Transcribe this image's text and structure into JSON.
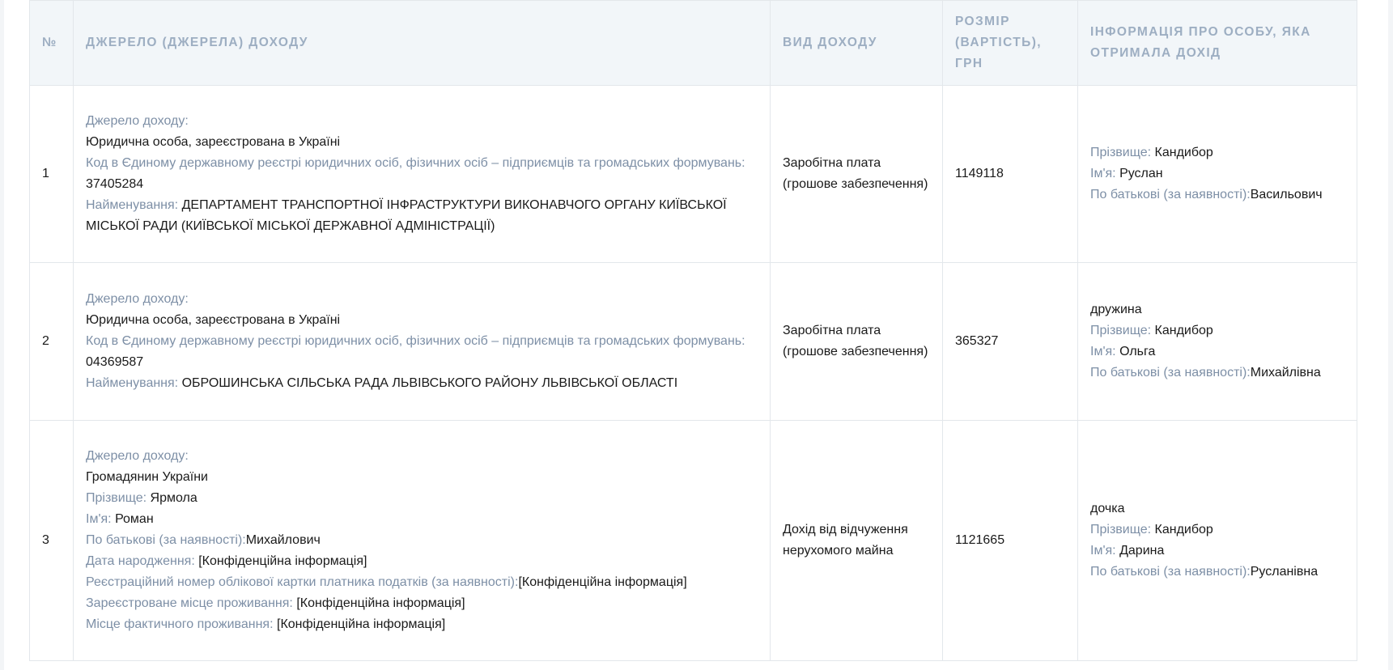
{
  "table": {
    "headers": {
      "no": "№",
      "source": "ДЖЕРЕЛО (ДЖЕРЕЛА) ДОХОДУ",
      "type": "ВИД ДОХОДУ",
      "amount": "РОЗМІР (ВАРТІСТЬ), ГРН",
      "person": "ІНФОРМАЦІЯ ПРО ОСОБУ, ЯКА ОТРИМАЛА ДОХІД"
    },
    "rows": [
      {
        "no": "1",
        "source": {
          "source_label": "Джерело доходу:",
          "entity_type": "Юридична особа, зареєстрована в Україні",
          "code_label": "Код в Єдиному державному реєстрі юридичних осіб, фізичних осіб – підприємців та громадських формувань:",
          "code_value": "37405284",
          "name_label": "Найменування:",
          "name_value": "ДЕПАРТАМЕНТ ТРАНСПОРТНОЇ ІНФРАСТРУКТУРИ ВИКОНАВЧОГО ОРГАНУ КИЇВСЬКОЇ МІСЬКОЇ РАДИ (КИЇВСЬКОЇ МІСЬКОЇ ДЕРЖАВНОЇ АДМІНІСТРАЦІЇ)"
        },
        "type": "Заробітна плата (грошове забезпечення)",
        "amount": "1149118",
        "person": {
          "relation": "",
          "surname_label": "Прізвище:",
          "surname_value": "Кандибор",
          "name_label": "Ім'я:",
          "name_value": "Руслан",
          "patronymic_label": "По батькові (за наявності):",
          "patronymic_value": "Васильович"
        }
      },
      {
        "no": "2",
        "source": {
          "source_label": "Джерело доходу:",
          "entity_type": "Юридична особа, зареєстрована в Україні",
          "code_label": "Код в Єдиному державному реєстрі юридичних осіб, фізичних осіб – підприємців та громадських формувань:",
          "code_value": "04369587",
          "name_label": "Найменування:",
          "name_value": "ОБРОШИНСЬКА СІЛЬСЬКА РАДА ЛЬВІВСЬКОГО РАЙОНУ ЛЬВІВСЬКОЇ ОБЛАСТІ"
        },
        "type": "Заробітна плата (грошове забезпечення)",
        "amount": "365327",
        "person": {
          "relation": "дружина",
          "surname_label": "Прізвище:",
          "surname_value": "Кандибор",
          "name_label": "Ім'я:",
          "name_value": "Ольга",
          "patronymic_label": "По батькові (за наявності):",
          "patronymic_value": "Михайлівна"
        }
      },
      {
        "no": "3",
        "source": {
          "source_label": "Джерело доходу:",
          "entity_type": "Громадянин України",
          "surname_label": "Прізвище:",
          "surname_value": "Ярмола",
          "name_label": "Ім'я:",
          "name_value": "Роман",
          "patronymic_label": "По батькові (за наявності):",
          "patronymic_value": "Михайлович",
          "birthdate_label": "Дата народження:",
          "birthdate_value": "[Конфіденційна інформація]",
          "tax_label": "Реєстраційний номер облікової картки платника податків (за наявності):",
          "tax_value": "[Конфіденційна інформація]",
          "reg_address_label": "Зареєстроване місце проживання:",
          "reg_address_value": "[Конфіденційна інформація]",
          "actual_address_label": "Місце фактичного проживання:",
          "actual_address_value": "[Конфіденційна інформація]"
        },
        "type": "Дохід від відчуження нерухомого майна",
        "amount": "1121665",
        "person": {
          "relation": "дочка",
          "surname_label": "Прізвище:",
          "surname_value": "Кандибор",
          "name_label": "Ім'я:",
          "name_value": "Дарина",
          "patronymic_label": "По батькові (за наявності):",
          "patronymic_value": "Русланівна"
        }
      }
    ]
  }
}
